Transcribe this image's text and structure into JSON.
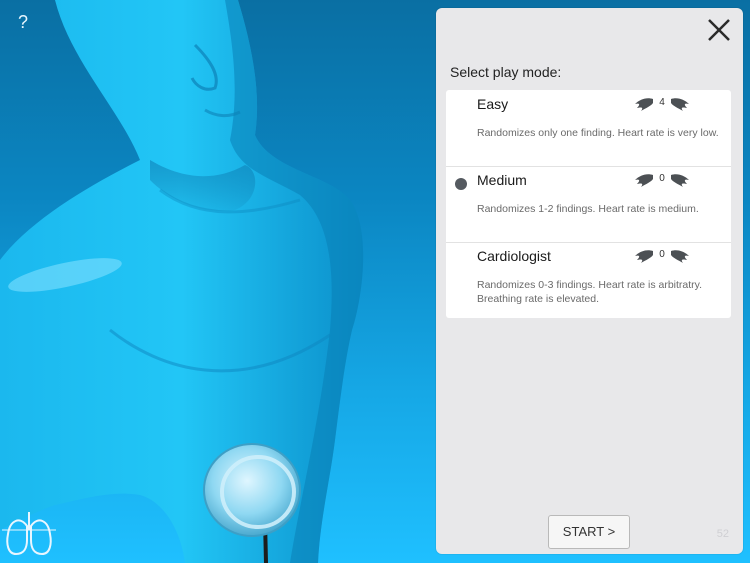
{
  "help": {
    "label": "?"
  },
  "panel": {
    "title": "Select play mode:",
    "options": [
      {
        "name": "Easy",
        "count": "4",
        "description": "Randomizes only one finding. Heart rate is  very low.",
        "selected": false
      },
      {
        "name": "Medium",
        "count": "0",
        "description": "Randomizes 1-2 findings. Heart rate is medium.",
        "selected": true
      },
      {
        "name": "Cardiologist",
        "count": "0",
        "description": "Randomizes 0-3 findings. Heart rate is arbitratry. Breathing rate is elevated.",
        "selected": false
      }
    ],
    "start_label": "START >",
    "corner_number": "52"
  },
  "colors": {
    "background_top": "#0a6fa3",
    "background_bottom": "#1fc0ff",
    "panel": "#e8e8ea",
    "radio": "#555a60",
    "wing": "#4c5054"
  },
  "icons": [
    "help-icon",
    "lungs-icon",
    "close-icon",
    "wing-icon",
    "stethoscope-icon"
  ]
}
